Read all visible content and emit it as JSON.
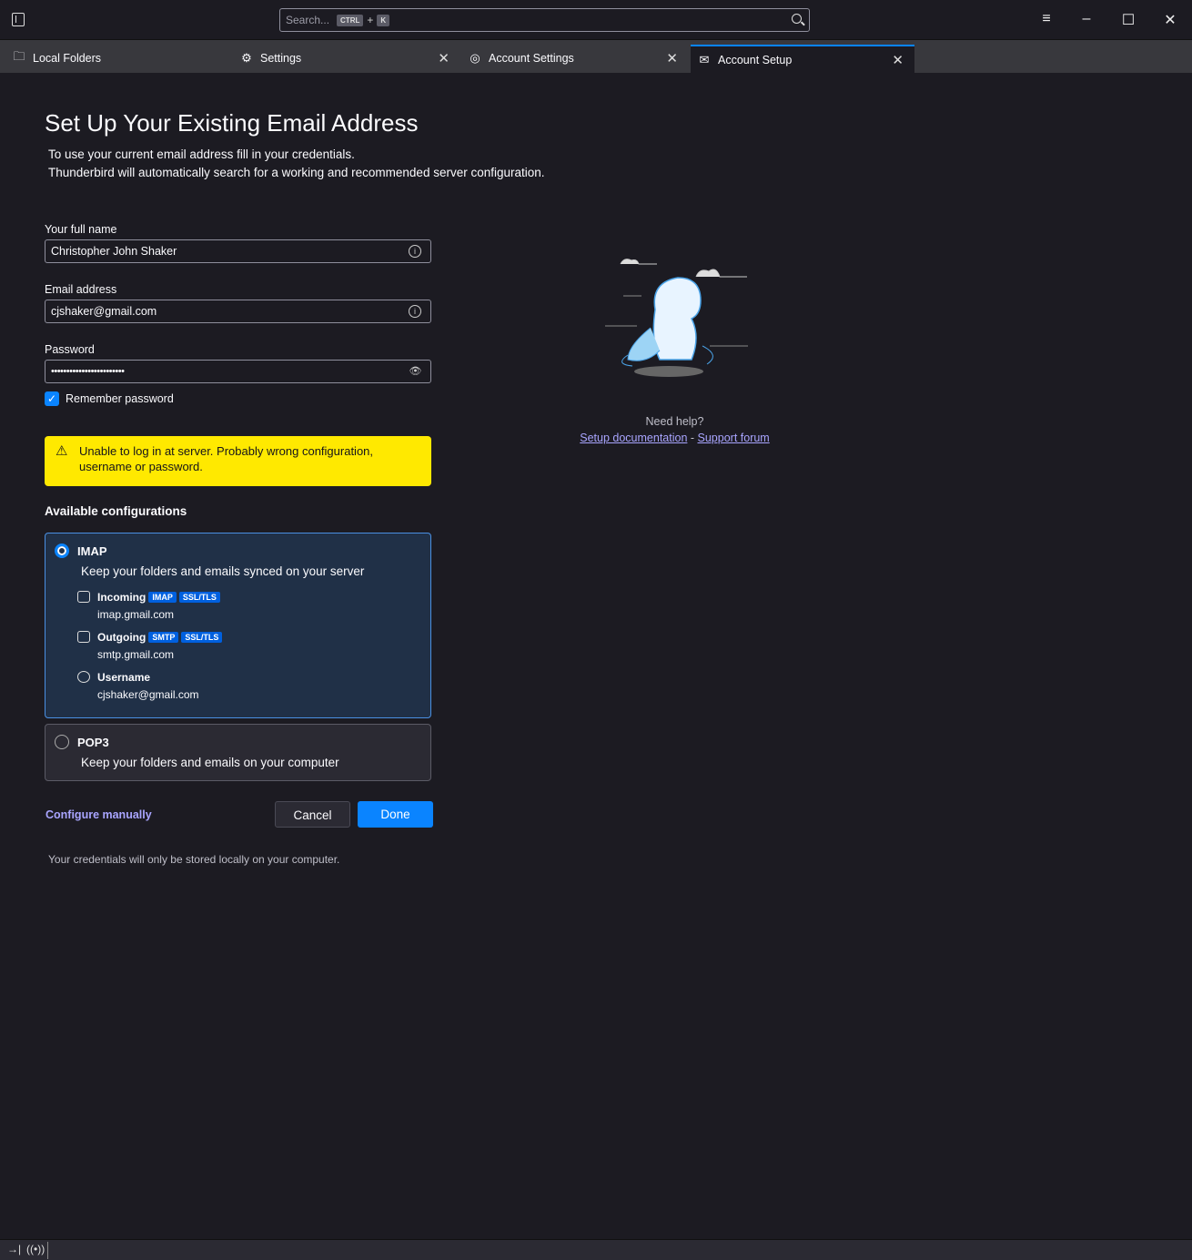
{
  "search": {
    "placeholder": "Search...",
    "kbd1": "CTRL",
    "plus": "+",
    "kbd2": "K"
  },
  "window": {
    "menu": "≡",
    "minimize": "–",
    "maximize": "☐",
    "close": "✕"
  },
  "tabs": [
    {
      "label": "Local Folders",
      "icon": "folder-icon"
    },
    {
      "label": "Settings",
      "icon": "gear-icon"
    },
    {
      "label": "Account Settings",
      "icon": "account-icon"
    },
    {
      "label": "Account Setup",
      "icon": "mail-icon",
      "active": true
    }
  ],
  "page": {
    "title": "Set Up Your Existing Email Address",
    "intro1": "To use your current email address fill in your credentials.",
    "intro2": "Thunderbird will automatically search for a working and recommended server configuration.",
    "name_label": "Your full name",
    "name_value": "Christopher John Shaker",
    "email_label": "Email address",
    "email_value": "cjshaker@gmail.com",
    "password_label": "Password",
    "password_value": "••••••••••••••••••••••••",
    "remember": "Remember password",
    "remember_checked": true,
    "warning": "Unable to log in at server. Probably wrong configuration, username or password.",
    "available": "Available configurations",
    "imap": {
      "name": "IMAP",
      "desc": "Keep your folders and emails synced on your server",
      "incoming_label": "Incoming",
      "incoming_badges": [
        "IMAP",
        "SSL/TLS"
      ],
      "incoming_host": "imap.gmail.com",
      "outgoing_label": "Outgoing",
      "outgoing_badges": [
        "SMTP",
        "SSL/TLS"
      ],
      "outgoing_host": "smtp.gmail.com",
      "username_label": "Username",
      "username_value": "cjshaker@gmail.com"
    },
    "pop3": {
      "name": "POP3",
      "desc": "Keep your folders and emails on your computer"
    },
    "configure_manually": "Configure manually",
    "cancel": "Cancel",
    "done": "Done",
    "footer": "Your credentials will only be stored locally on your computer.",
    "help": {
      "need": "Need help?",
      "doc": "Setup documentation",
      "sep": " - ",
      "forum": "Support forum"
    }
  },
  "colors": {
    "accent": "#0a84ff",
    "warning": "#ffe900",
    "link": "#a9a5ff"
  }
}
